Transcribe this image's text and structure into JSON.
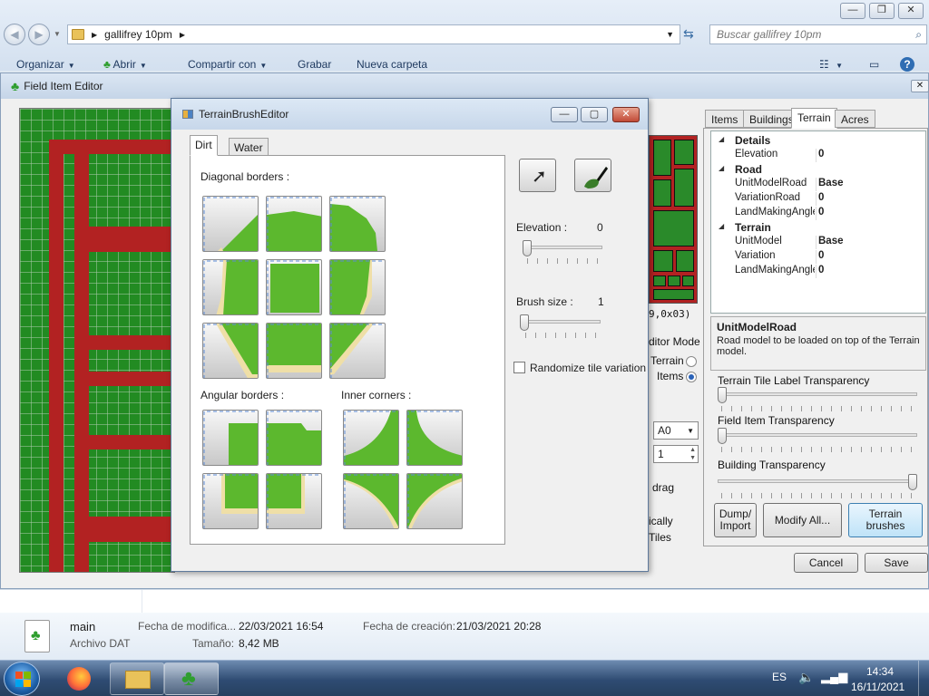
{
  "explorer": {
    "path_segments": [
      "gallifrey 10pm"
    ],
    "search_placeholder": "Buscar gallifrey 10pm",
    "toolbar": {
      "organize": "Organizar",
      "open": "Abrir",
      "share": "Compartir con",
      "burn": "Grabar",
      "new_folder": "Nueva carpeta"
    },
    "details": {
      "filename": "main",
      "filetype": "Archivo DAT",
      "modified_label": "Fecha de modifica...",
      "modified_value": "22/03/2021 16:54",
      "created_label": "Fecha de creación:",
      "created_value": "21/03/2021 20:28",
      "size_label": "Tamaño:",
      "size_value": "8,42 MB"
    }
  },
  "field_item_editor": {
    "title": "Field Item Editor",
    "coords_text": "9,0x03)",
    "editor_mode_label": "ditor Mode",
    "mode_terrain": "Terrain",
    "mode_items": "Items",
    "selected_mode": "Items",
    "acre_select_value": "A0",
    "spinner_value": "1",
    "drag_label": "drag",
    "partial_text_1": "ically",
    "partial_text_2": "Tiles",
    "tabs": [
      "Items",
      "Buildings",
      "Terrain",
      "Acres"
    ],
    "active_tab": "Terrain",
    "properties": [
      {
        "category": "Details",
        "rows": [
          {
            "name": "Elevation",
            "value": "0"
          }
        ]
      },
      {
        "category": "Road",
        "rows": [
          {
            "name": "UnitModelRoad",
            "value": "Base"
          },
          {
            "name": "VariationRoad",
            "value": "0"
          },
          {
            "name": "LandMakingAngle",
            "value": "0"
          }
        ]
      },
      {
        "category": "Terrain",
        "rows": [
          {
            "name": "UnitModel",
            "value": "Base"
          },
          {
            "name": "Variation",
            "value": "0"
          },
          {
            "name": "LandMakingAngle",
            "value": "0"
          }
        ]
      }
    ],
    "description_title": "UnitModelRoad",
    "description_text": "Road model to be loaded on top of the Terrain model.",
    "terrain_label_transparency": "Terrain Tile Label Transparency",
    "field_item_transparency": "Field Item Transparency",
    "building_transparency": "Building Transparency",
    "terrain_label_transparency_level": 0,
    "field_item_transparency_level": 0,
    "building_transparency_level": 1,
    "buttons": {
      "dump_import": "Dump/ Import",
      "modify_all": "Modify All...",
      "terrain_brushes": "Terrain brushes",
      "cancel": "Cancel",
      "save": "Save"
    }
  },
  "terrain_brush_editor": {
    "title": "TerrainBrushEditor",
    "tabs": [
      "Dirt",
      "Water"
    ],
    "active_tab": "Dirt",
    "diagonal_label": "Diagonal borders :",
    "angular_label": "Angular borders :",
    "inner_label": "Inner corners :",
    "elevation_label": "Elevation :",
    "elevation_value": "0",
    "brush_size_label": "Brush size :",
    "brush_size_value": "1",
    "randomize_label": "Randomize tile variation",
    "randomize_checked": false,
    "colors": {
      "grass": "#5cb82e",
      "sand": "#efdfa7",
      "edge": "#a97b4a"
    }
  },
  "taskbar": {
    "language": "ES",
    "time": "14:34",
    "date": "16/11/2021",
    "apps": [
      "start-orb",
      "firefox",
      "windows-explorer",
      "field-item-editor"
    ]
  }
}
